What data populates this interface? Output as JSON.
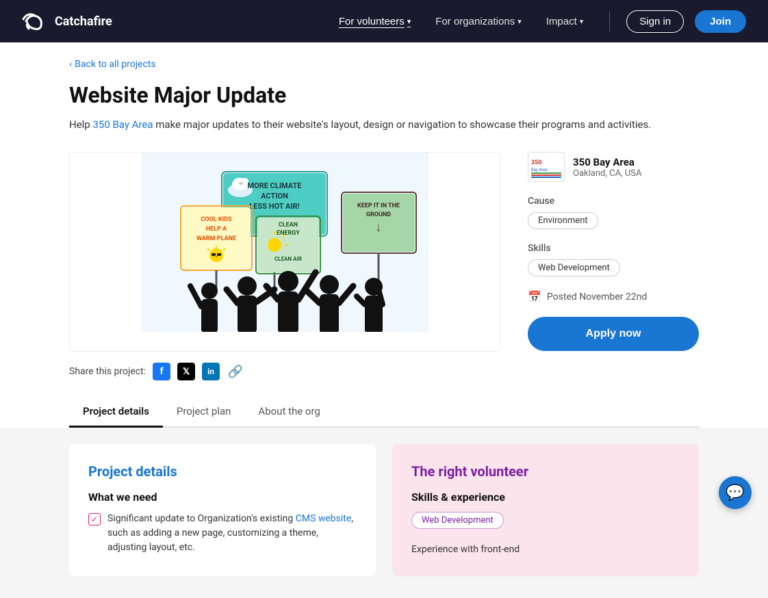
{
  "nav": {
    "logo_text": "Catchafire",
    "links": [
      {
        "label": "For volunteers",
        "active": true,
        "has_dropdown": true
      },
      {
        "label": "For organizations",
        "active": false,
        "has_dropdown": true
      },
      {
        "label": "Impact",
        "active": false,
        "has_dropdown": true
      }
    ],
    "signin_label": "Sign in",
    "join_label": "Join"
  },
  "breadcrumb": {
    "arrow": "‹",
    "label": "Back to all projects"
  },
  "project": {
    "title": "Website Major Update",
    "description_prefix": "Help ",
    "org_link_text": "350 Bay Area",
    "description_suffix": " make major updates to their website's layout, design or navigation to showcase their programs and activities.",
    "share_label": "Share this project:"
  },
  "org_card": {
    "name": "350 Bay Area",
    "location": "Oakland, CA, USA"
  },
  "cause": {
    "label": "Cause",
    "tag": "Environment"
  },
  "skills": {
    "label": "Skills",
    "tag": "Web Development"
  },
  "posted": {
    "icon": "📅",
    "text": "Posted November 22nd"
  },
  "apply_button": "Apply now",
  "tabs": [
    {
      "label": "Project details",
      "active": true
    },
    {
      "label": "Project plan",
      "active": false
    },
    {
      "label": "About the org",
      "active": false
    }
  ],
  "detail_card": {
    "title": "Project details",
    "what_we_need": "What we need",
    "checkbox_text": "Significant update to Organization's existing CMS website, such as adding a new page, customizing a theme, adjusting layout, etc.",
    "cms_link": "CMS website"
  },
  "right_card": {
    "title": "The right volunteer",
    "skills_title": "Skills & experience",
    "skill_tag": "Web Development",
    "experience_label": "Experience with front-end"
  },
  "chat": {
    "icon": "💬"
  }
}
